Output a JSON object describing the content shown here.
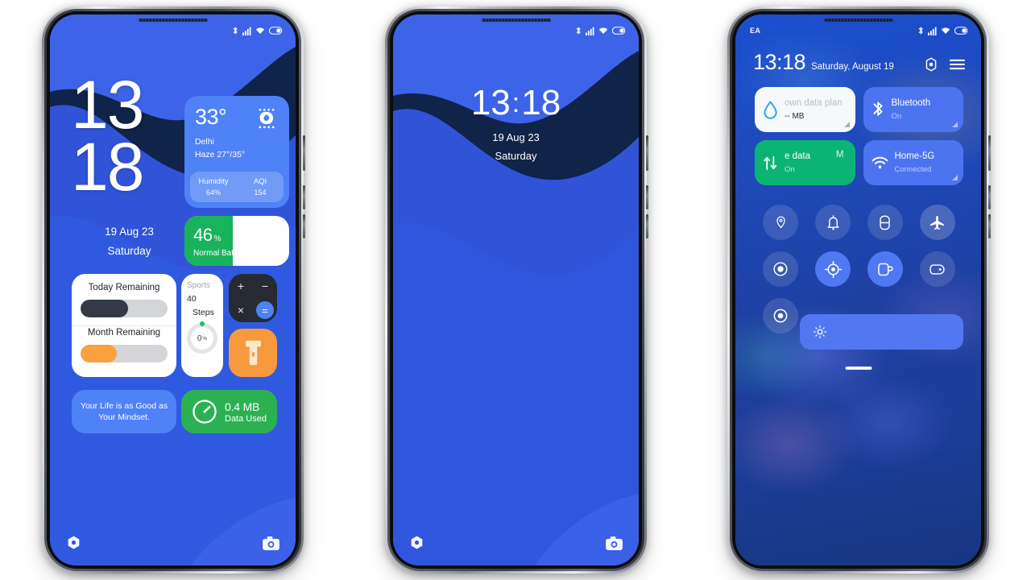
{
  "phones": [
    {
      "id": "home-screen",
      "status_bar": {
        "carrier": "",
        "icons": [
          "bluetooth-icon",
          "signal-icon",
          "wifi-icon",
          "battery-icon"
        ]
      },
      "clock": {
        "hour": "13",
        "minute": "18",
        "date": "19 Aug 23",
        "weekday": "Saturday"
      },
      "weather": {
        "temperature": "33°",
        "city": "Delhi",
        "condition": "Haze 27°/35°",
        "humidity_label": "Humidity",
        "humidity_value": "64%",
        "aqi_label": "AQI",
        "aqi_value": "154",
        "icon": "haze-icon",
        "accent": "#4f82f6"
      },
      "battery": {
        "value": "46",
        "unit": "%",
        "label": "Normal Battery",
        "percent": 46,
        "accent": "#19b35c"
      },
      "remaining": {
        "today_label": "Today Remaining",
        "today_percent": 55,
        "today_color": "#333a46",
        "month_label": "Month Remaining",
        "month_percent": 42,
        "month_color": "#f9a03f"
      },
      "sports": {
        "title": "Sports",
        "count": "40",
        "unit": "Steps",
        "ring_value": "0",
        "ring_unit": "%",
        "ring_percent": 0,
        "dot_color": "#14c35c"
      },
      "calculator": {
        "plus": "+",
        "minus": "−",
        "times": "×",
        "equals": "=",
        "accent": "#4f82f6",
        "bg": "#262b33"
      },
      "flashlight": {
        "icon": "flashlight-icon",
        "bg": "#f79a3e"
      },
      "quote": {
        "text": "Your Life is as Good as Your Mindset.",
        "bg": "#4f82f6"
      },
      "data_used": {
        "value": "0.4 MB",
        "label": "Data Used",
        "icon": "speedometer-icon",
        "bg": "#2cb152"
      },
      "shortcuts": {
        "left": "flashlight-shortcut-icon",
        "right": "camera-shortcut-icon"
      }
    },
    {
      "id": "lock-screen",
      "clock": {
        "hour": "13",
        "colon": ":",
        "minute": "18",
        "date": "19 Aug 23",
        "weekday": "Saturday"
      },
      "shortcuts": {
        "left": "flashlight-shortcut-icon",
        "right": "camera-shortcut-icon"
      }
    },
    {
      "id": "control-center",
      "status_bar": {
        "carrier": "EA",
        "icons": [
          "bluetooth-icon",
          "signal-icon",
          "wifi-icon",
          "battery-icon"
        ]
      },
      "header": {
        "time": "13:18",
        "date": "Saturday, August 19",
        "settings_icon": "settings-gear-icon",
        "menu_icon": "menu-icon"
      },
      "tiles": [
        {
          "name": "data-plan",
          "title": "own data plan",
          "subtitle": "--  MB",
          "icon": "water-drop-icon",
          "style": "light"
        },
        {
          "name": "bluetooth",
          "title": "Bluetooth",
          "subtitle": "On",
          "icon": "bluetooth-icon",
          "style": "blue"
        },
        {
          "name": "mobile-data",
          "title": "e data",
          "subtitle": "On",
          "icon": "data-transfer-icon",
          "style": "green",
          "ghost": "M"
        },
        {
          "name": "wifi",
          "title": "Home-5G",
          "subtitle": "Connected",
          "icon": "wifi-icon",
          "style": "blue"
        }
      ],
      "toggles": [
        {
          "name": "location",
          "icon": "location-pin-icon",
          "state": "off"
        },
        {
          "name": "sound",
          "icon": "bell-icon",
          "state": "off"
        },
        {
          "name": "auto-rotate",
          "icon": "rotation-lock-icon",
          "state": "off"
        },
        {
          "name": "airplane-mode",
          "icon": "airplane-icon",
          "state": "off"
        },
        {
          "name": "screen-recorder",
          "icon": "record-circle-icon",
          "state": "off"
        },
        {
          "name": "gps",
          "icon": "gps-target-icon",
          "state": "on"
        },
        {
          "name": "cast",
          "icon": "cast-screen-icon",
          "state": "on"
        },
        {
          "name": "reading-mode",
          "icon": "reading-mode-icon",
          "state": "off"
        },
        {
          "name": "dark-mode",
          "icon": "dark-mode-circle-icon",
          "state": "off"
        }
      ],
      "brightness": {
        "icon": "sun-icon",
        "level": 0,
        "accent": "#5277f1"
      },
      "handle": "drag-handle"
    }
  ]
}
